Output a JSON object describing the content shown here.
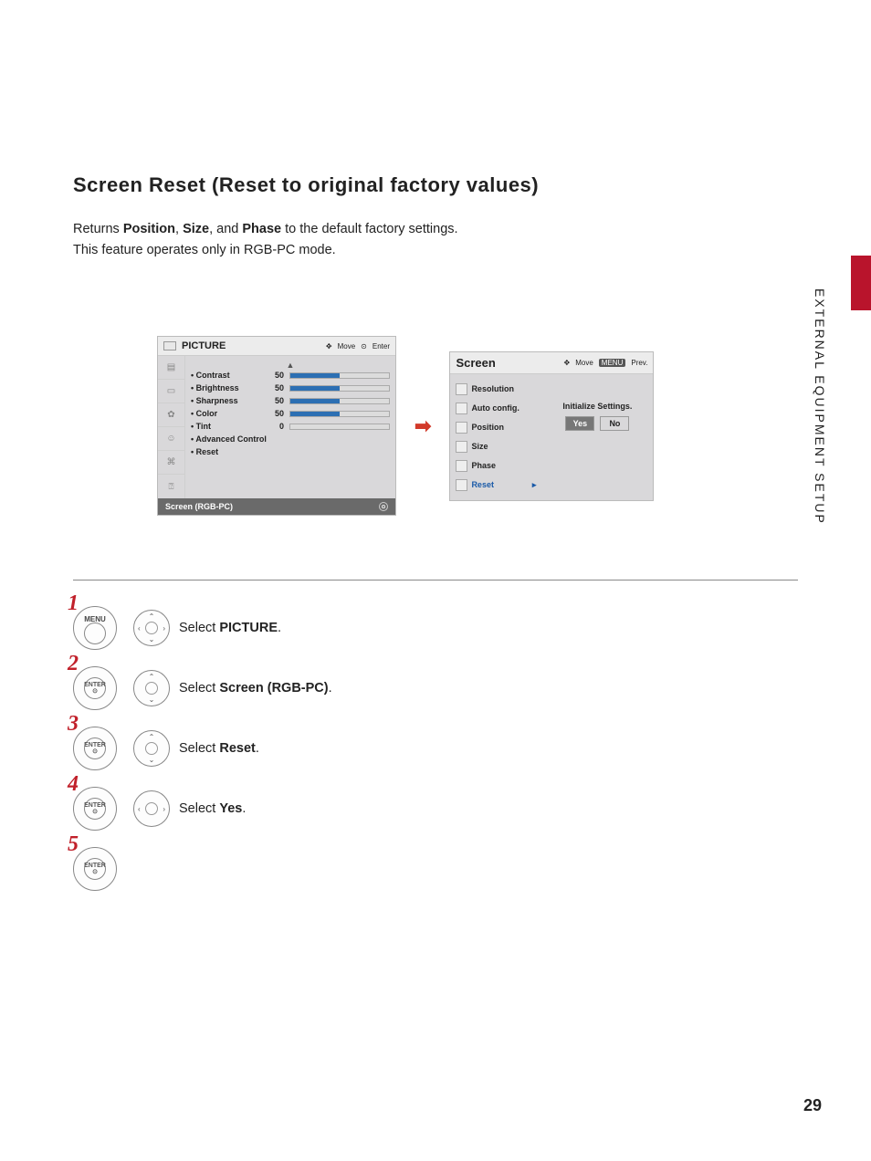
{
  "heading": "Screen Reset (Reset to original factory values)",
  "intro": {
    "pre": "Returns ",
    "b1": "Position",
    "sep1": ", ",
    "b2": "Size",
    "sep2": ", and ",
    "b3": "Phase",
    "post": " to the default factory settings."
  },
  "intro2": "This feature operates only in RGB-PC mode.",
  "osd": {
    "picture": {
      "title": "PICTURE",
      "hints_move": "Move",
      "hints_enter": "Enter",
      "rows": [
        {
          "lbl": "• Contrast",
          "val": "50"
        },
        {
          "lbl": "• Brightness",
          "val": "50"
        },
        {
          "lbl": "• Sharpness",
          "val": "50"
        },
        {
          "lbl": "• Color",
          "val": "50"
        }
      ],
      "tint": {
        "lbl": "• Tint",
        "val": "0"
      },
      "advanced": "• Advanced Control",
      "reset": "• Reset",
      "footer": "Screen (RGB-PC)"
    },
    "screen": {
      "title": "Screen",
      "hints_move": "Move",
      "hints_prev": "Prev.",
      "hints_prev_badge": "MENU",
      "items": [
        "Resolution",
        "Auto config.",
        "Position",
        "Size",
        "Phase",
        "Reset"
      ],
      "init": "Initialize Settings.",
      "yes": "Yes",
      "no": "No"
    }
  },
  "steps": [
    {
      "n": "1",
      "btn": "MENU",
      "dpad": "4",
      "text_pre": "Select ",
      "text_b": "PICTURE",
      "text_post": "."
    },
    {
      "n": "2",
      "btn": "ENTER",
      "dpad": "ud",
      "text_pre": "Select ",
      "text_b": "Screen (RGB-PC)",
      "text_post": "."
    },
    {
      "n": "3",
      "btn": "ENTER",
      "dpad": "ud",
      "text_pre": "Select ",
      "text_b": "Reset",
      "text_post": "."
    },
    {
      "n": "4",
      "btn": "ENTER",
      "dpad": "lr",
      "text_pre": "Select ",
      "text_b": "Yes",
      "text_post": "."
    },
    {
      "n": "5",
      "btn": "ENTER",
      "dpad": "",
      "text_pre": "",
      "text_b": "",
      "text_post": ""
    }
  ],
  "side_label": "EXTERNAL EQUIPMENT SETUP",
  "pagenum": "29"
}
